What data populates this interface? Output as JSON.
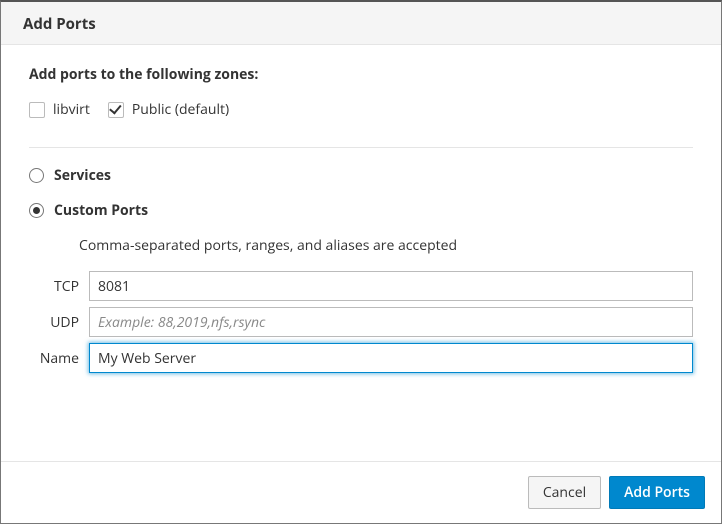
{
  "dialog": {
    "title": "Add Ports",
    "zones_heading": "Add ports to the following zones:",
    "zones": [
      {
        "label": "libvirt",
        "checked": false
      },
      {
        "label": "Public (default)",
        "checked": true
      }
    ],
    "mode": {
      "services_label": "Services",
      "custom_label": "Custom Ports",
      "selected": "custom"
    },
    "custom": {
      "help": "Comma-separated ports, ranges, and aliases are accepted",
      "tcp_label": "TCP",
      "tcp_value": "8081",
      "udp_label": "UDP",
      "udp_placeholder": "Example: 88,2019,nfs,rsync",
      "udp_value": "",
      "name_label": "Name",
      "name_value": "My Web Server"
    },
    "buttons": {
      "cancel": "Cancel",
      "submit": "Add Ports"
    }
  }
}
